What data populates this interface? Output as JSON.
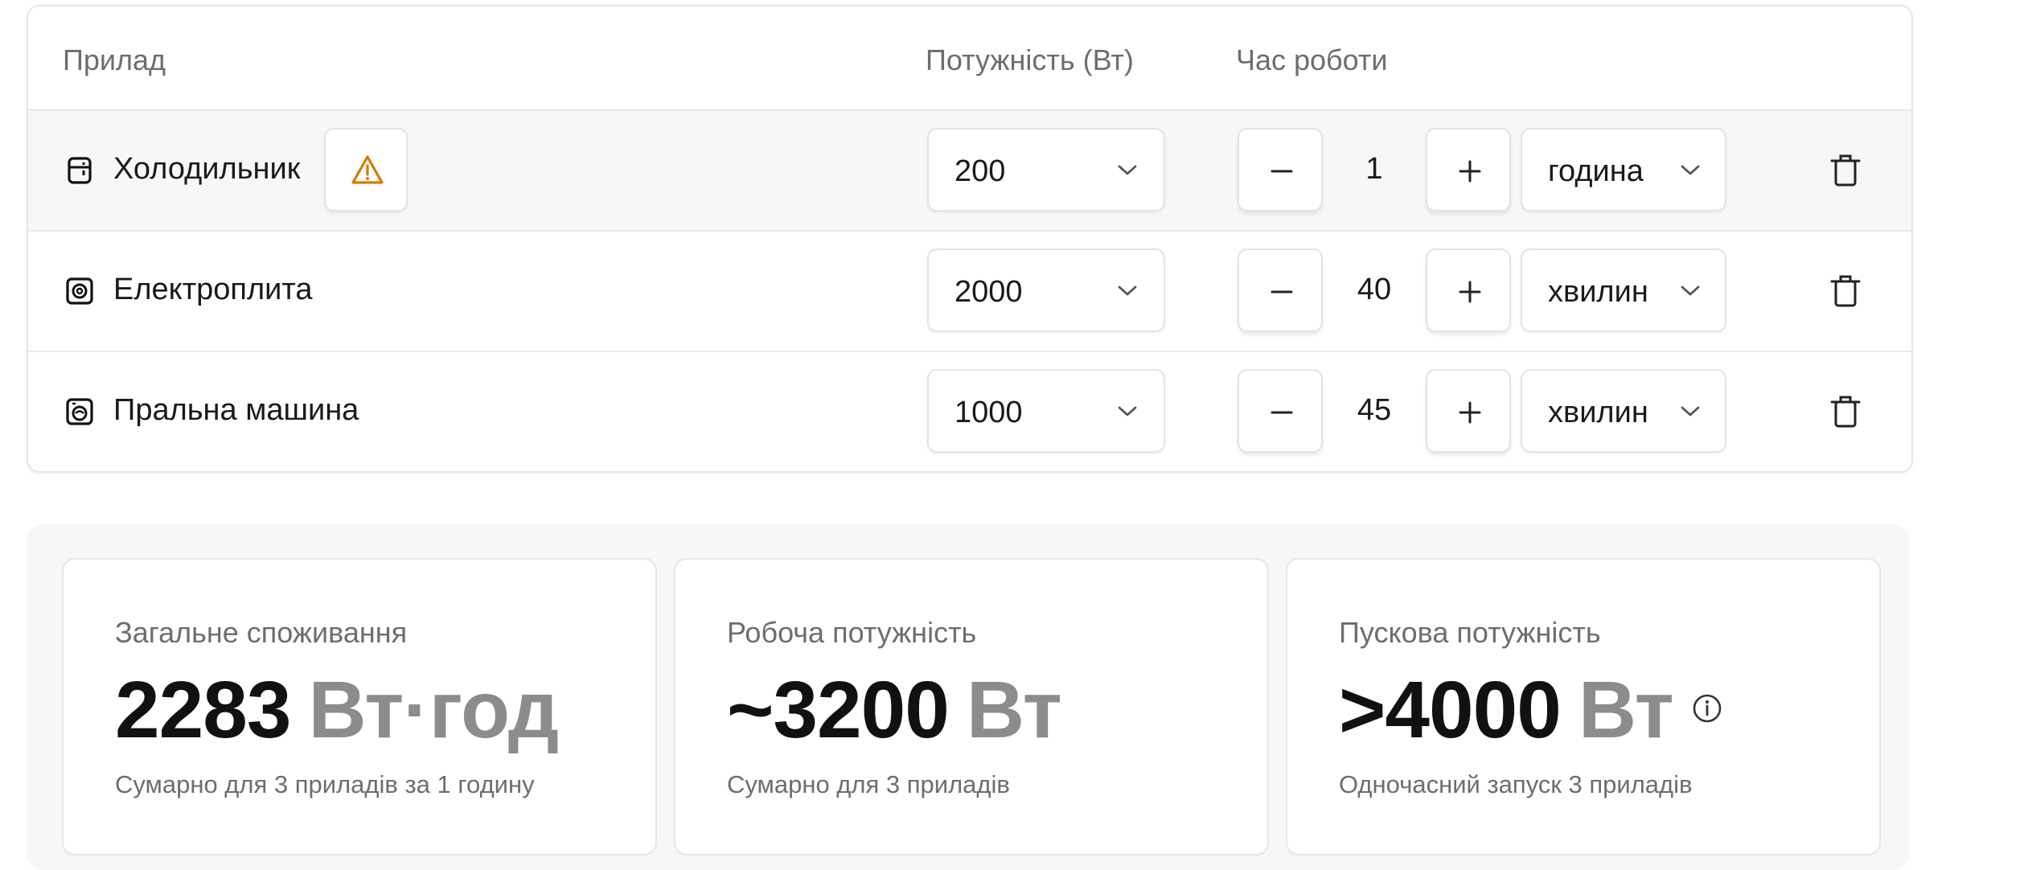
{
  "table": {
    "headers": {
      "device": "Прилад",
      "power": "Потужність (Вт)",
      "time": "Час роботи"
    },
    "rows": [
      {
        "icon": "fridge-icon",
        "name": "Холодильник",
        "warning": true,
        "power": "200",
        "time_value": "1",
        "time_unit": "година",
        "highlighted": true
      },
      {
        "icon": "stove-icon",
        "name": "Електроплита",
        "warning": false,
        "power": "2000",
        "time_value": "40",
        "time_unit": "хвилин",
        "highlighted": false
      },
      {
        "icon": "washing-machine-icon",
        "name": "Пральна машина",
        "warning": false,
        "power": "1000",
        "time_value": "45",
        "time_unit": "хвилин",
        "highlighted": false
      }
    ]
  },
  "summary": {
    "total_consumption": {
      "label": "Загальне споживання",
      "value": "2283",
      "unit": "Вт·год",
      "caption": "Сумарно для 3 приладів за 1 годину"
    },
    "working_power": {
      "label": "Робоча потужність",
      "value": "~3200",
      "unit": "Вт",
      "caption": "Сумарно для 3 приладів"
    },
    "starting_power": {
      "label": "Пускова потужність",
      "value": ">4000",
      "unit": "Вт",
      "caption": "Одночасний запуск 3 приладів"
    }
  },
  "colors": {
    "warning": "#d97706",
    "muted_text": "#6d6d6d",
    "unit_text": "#8c8c8c"
  }
}
